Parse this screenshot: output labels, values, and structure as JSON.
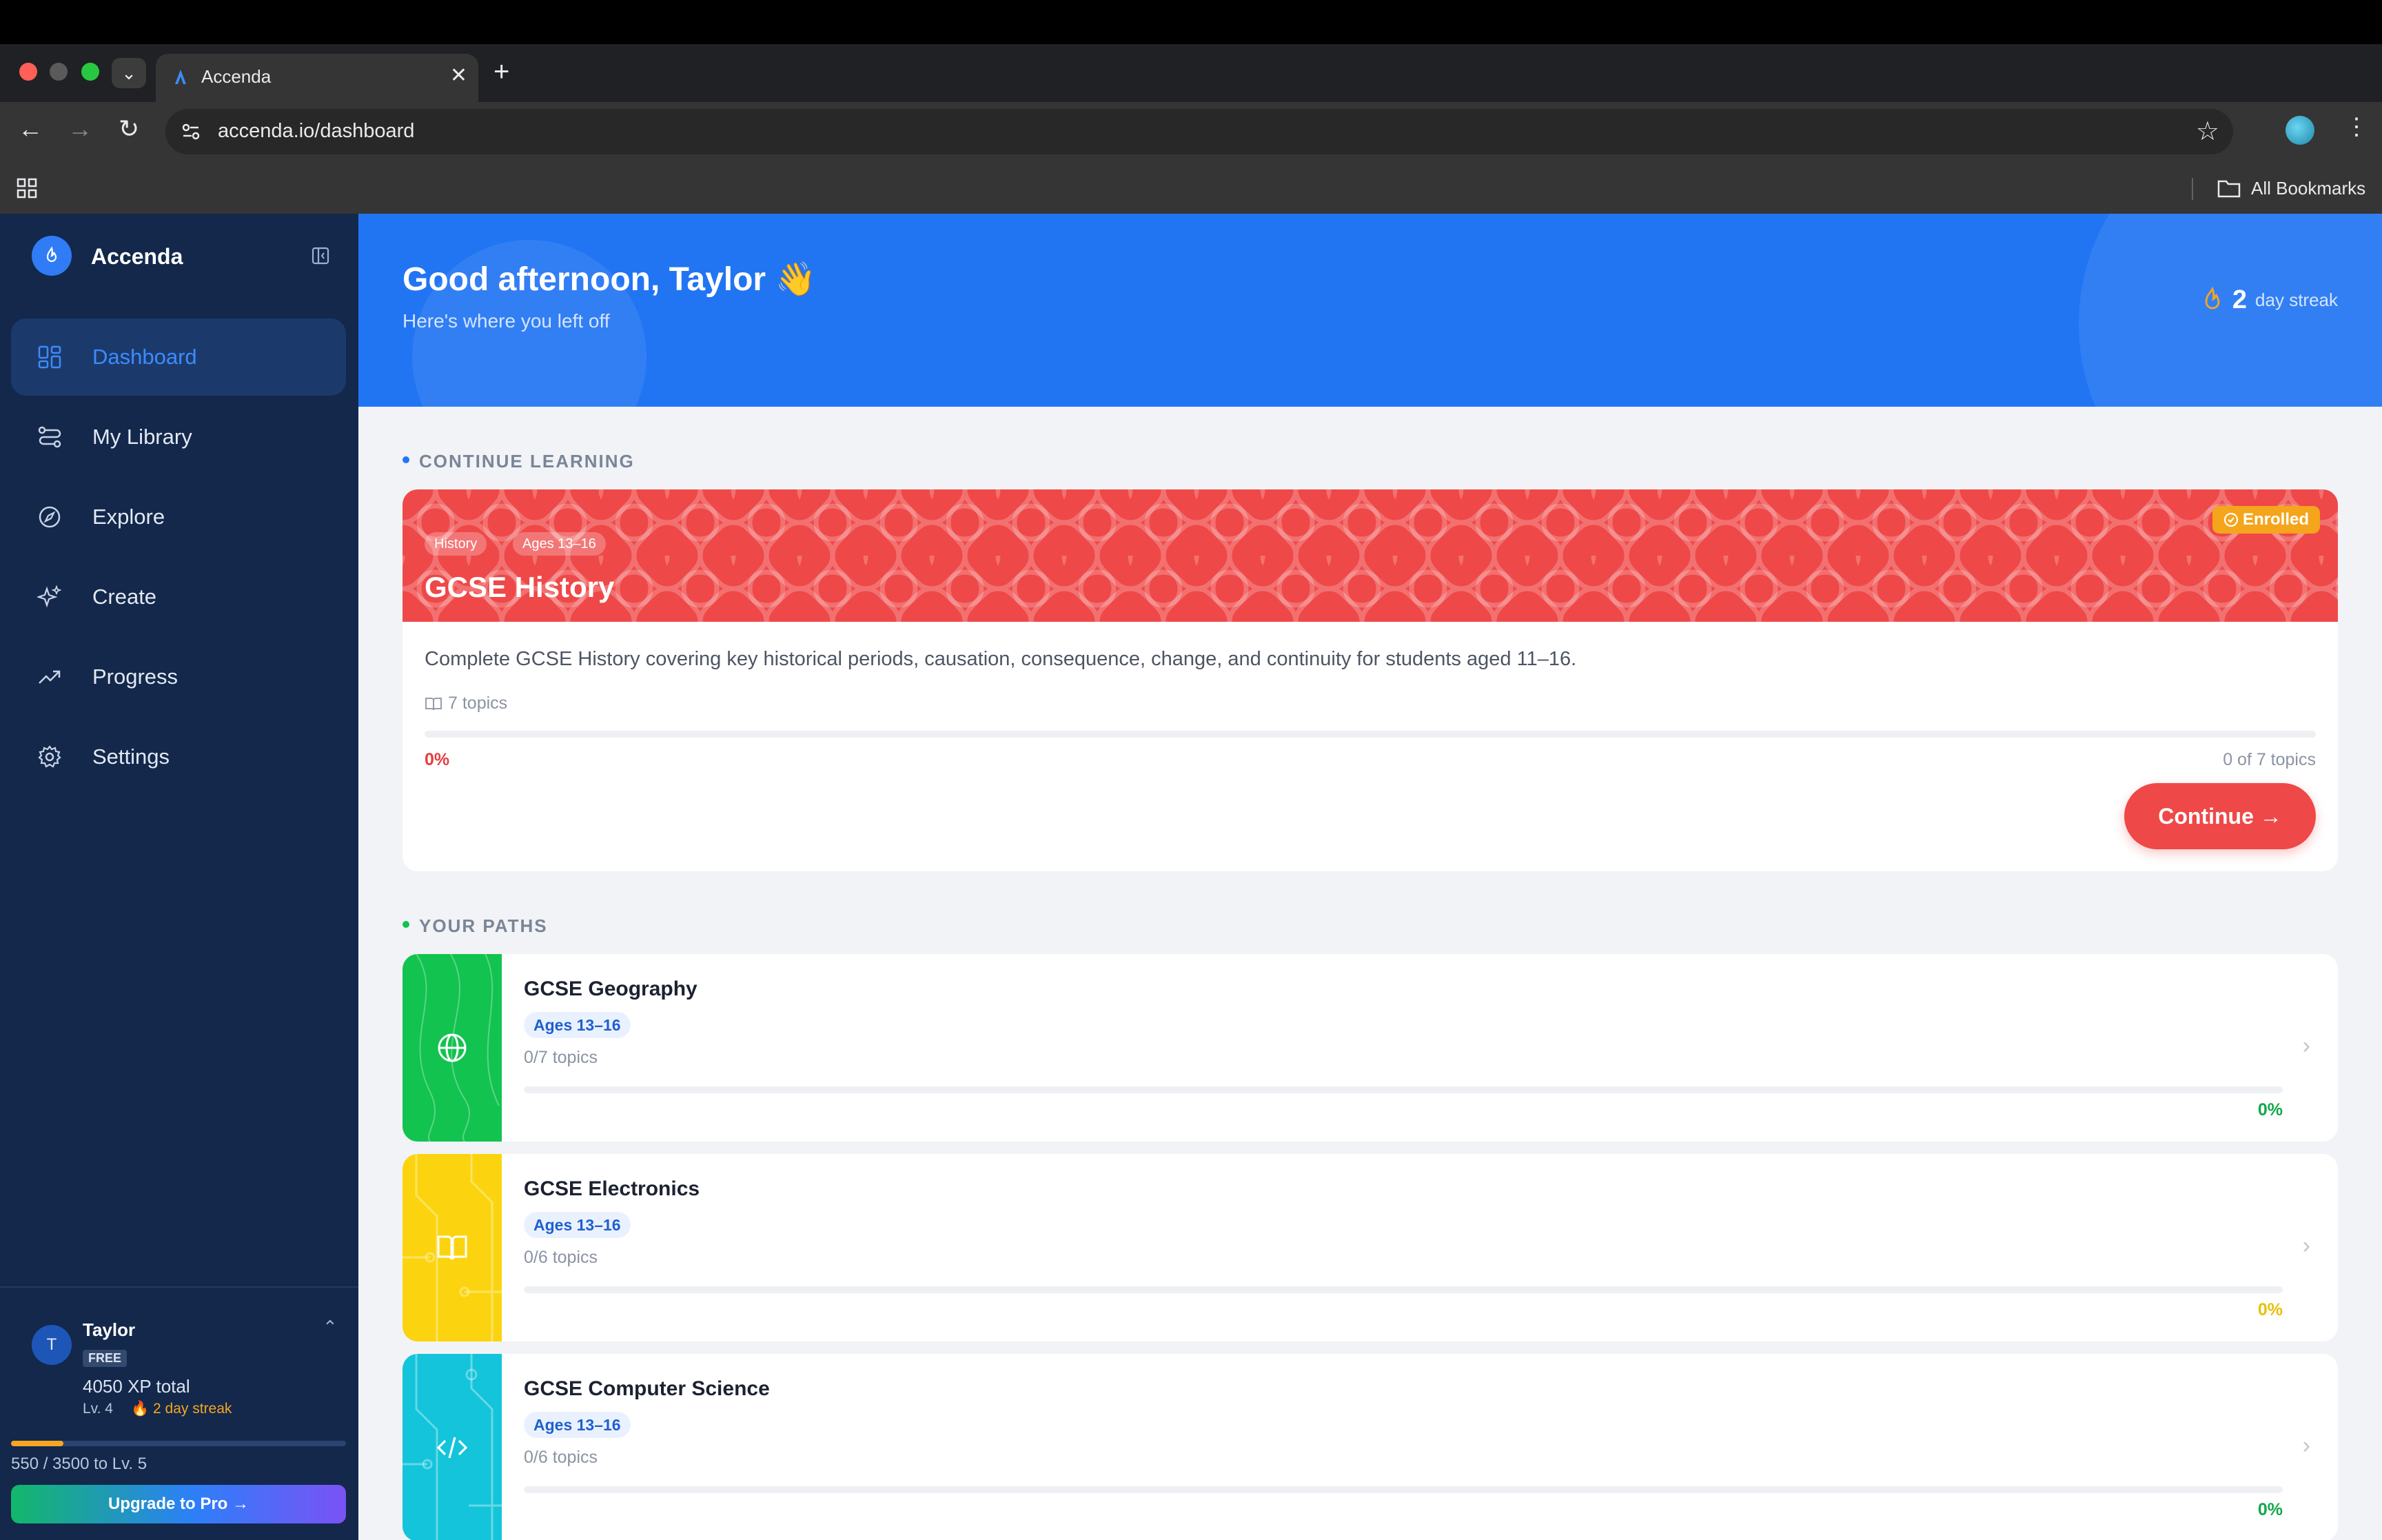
{
  "browser": {
    "tab_title": "Accenda",
    "url": "accenda.io/dashboard",
    "bookmarks_label": "All Bookmarks"
  },
  "sidebar": {
    "brand": "Accenda",
    "items": [
      {
        "label": "Dashboard",
        "icon": "dashboard-icon",
        "active": true
      },
      {
        "label": "My Library",
        "icon": "library-icon",
        "active": false
      },
      {
        "label": "Explore",
        "icon": "compass-icon",
        "active": false
      },
      {
        "label": "Create",
        "icon": "sparkle-icon",
        "active": false
      },
      {
        "label": "Progress",
        "icon": "trending-up-icon",
        "active": false
      },
      {
        "label": "Settings",
        "icon": "gear-icon",
        "active": false
      }
    ],
    "user": {
      "initial": "T",
      "name": "Taylor",
      "plan": "FREE",
      "xp_total": "4050 XP total",
      "level": "Lv. 4",
      "streak": "2 day streak",
      "xp_progress": 0.157,
      "xp_caption": "550 / 3500 to Lv. 5",
      "upgrade_label": "Upgrade to Pro →"
    }
  },
  "hero": {
    "greeting": "Good afternoon, Taylor 👋",
    "subtitle": "Here's where you left off",
    "streak_count": "2",
    "streak_label": "day streak"
  },
  "continue_section": {
    "label": "CONTINUE LEARNING",
    "course": {
      "tags": [
        "History",
        "Ages 13–16"
      ],
      "title": "GCSE History",
      "status": "Enrolled",
      "description": "Complete GCSE History covering key historical periods, causation, consequence, change, and continuity for students aged 11–16.",
      "topics": "7 topics",
      "progress": 0,
      "percent_label": "0%",
      "count_label": "0 of 7 topics",
      "continue_label": "Continue →",
      "accent": "#ef4848"
    }
  },
  "paths_section": {
    "label": "YOUR PATHS",
    "paths": [
      {
        "title": "GCSE Geography",
        "age": "Ages 13–16",
        "topics": "0/7 topics",
        "percent_label": "0%",
        "progress": 0,
        "color": "#12c34f",
        "pct_color": "#12a84a",
        "icon": "globe-icon"
      },
      {
        "title": "GCSE Electronics",
        "age": "Ages 13–16",
        "topics": "0/6 topics",
        "percent_label": "0%",
        "progress": 0,
        "color": "#fbd40f",
        "pct_color": "#e8c00a",
        "icon": "book-icon"
      },
      {
        "title": "GCSE Computer Science",
        "age": "Ages 13–16",
        "topics": "0/6 topics",
        "percent_label": "0%",
        "progress": 0,
        "color": "#13c4da",
        "pct_color": "#12a84a",
        "icon": "code-icon"
      }
    ]
  }
}
